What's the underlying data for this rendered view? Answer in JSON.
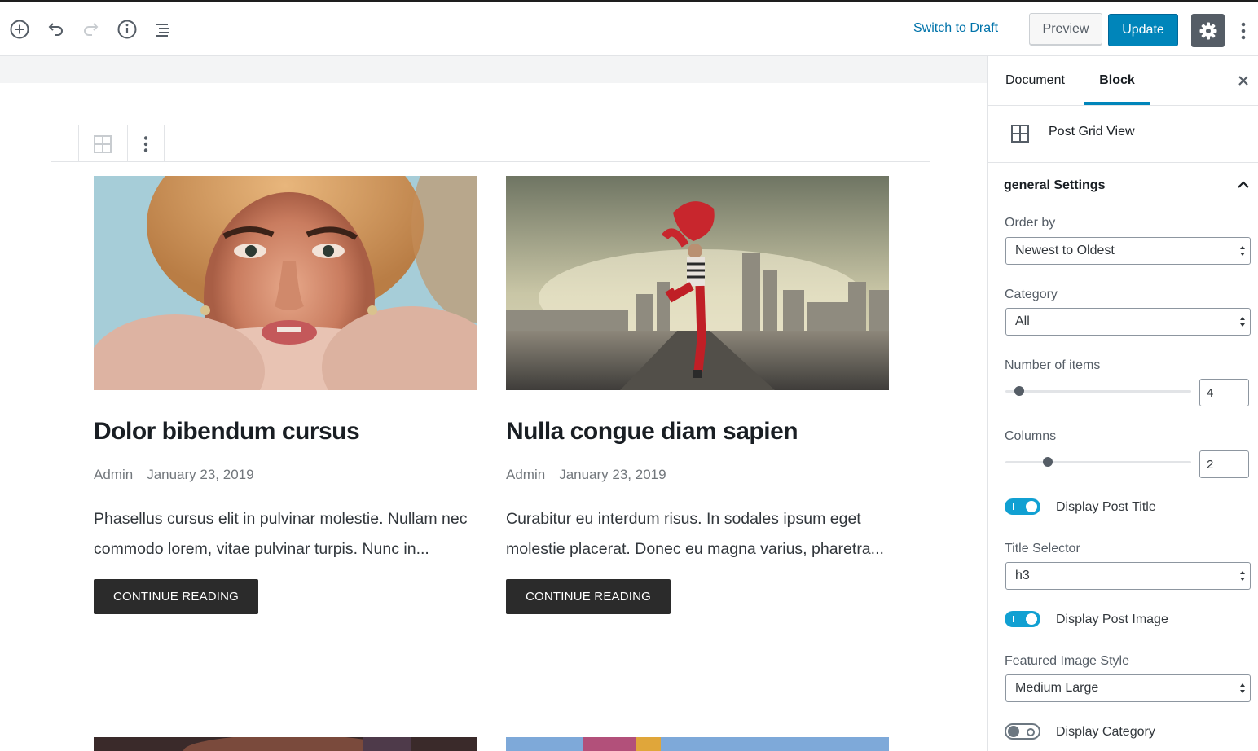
{
  "toolbar": {
    "switch_to_draft": "Switch to Draft",
    "preview": "Preview",
    "update": "Update",
    "icons": [
      "add-block-icon",
      "undo-icon",
      "redo-icon",
      "info-icon",
      "outline-icon",
      "gear-icon",
      "more-vertical-icon"
    ],
    "accent_color": "#0085ba"
  },
  "posts": [
    {
      "title": "Dolor bibendum cursus",
      "author": "Admin",
      "date": "January 23, 2019",
      "excerpt": "Phasellus cursus elit in pulvinar molestie. Nullam nec commodo lorem, vitae pulvinar turpis. Nunc in...",
      "button": "CONTINUE READING"
    },
    {
      "title": "Nulla congue diam sapien",
      "author": "Admin",
      "date": "January 23, 2019",
      "excerpt": "Curabitur eu interdum risus. In sodales ipsum eget molestie placerat. Donec eu magna varius, pharetra...",
      "button": "CONTINUE READING"
    }
  ],
  "sidebar": {
    "tabs": {
      "document": "Document",
      "block": "Block",
      "active": "Block"
    },
    "block_name": "Post Grid View",
    "panel_title": "general Settings",
    "order_by": {
      "label": "Order by",
      "value": "Newest to Oldest"
    },
    "category": {
      "label": "Category",
      "value": "All"
    },
    "number_of_items": {
      "label": "Number of items",
      "value": "4"
    },
    "columns": {
      "label": "Columns",
      "value": "2"
    },
    "display_post_title": {
      "label": "Display Post Title",
      "on": true
    },
    "title_selector": {
      "label": "Title Selector",
      "value": "h3"
    },
    "display_post_image": {
      "label": "Display Post Image",
      "on": true
    },
    "featured_image_style": {
      "label": "Featured Image Style",
      "value": "Medium Large"
    },
    "display_category": {
      "label": "Display Category",
      "on": false
    }
  }
}
